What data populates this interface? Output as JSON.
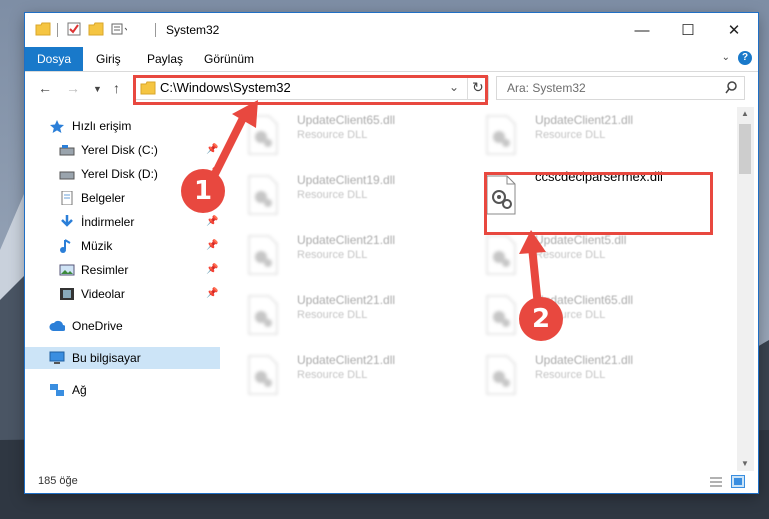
{
  "window": {
    "title": "System32",
    "controls": {
      "minimize": "—",
      "maximize": "☐",
      "close": "✕"
    }
  },
  "ribbon": {
    "tabs": [
      {
        "label": "Dosya",
        "active": true
      },
      {
        "label": "Giriş"
      },
      {
        "label": "Paylaş"
      },
      {
        "label": "Görünüm"
      }
    ],
    "help": "?"
  },
  "address": {
    "path": "C:\\Windows\\System32",
    "search_placeholder": "Ara: System32"
  },
  "sidebar": {
    "items": [
      {
        "label": "Hızlı erişim",
        "icon": "star-icon"
      },
      {
        "label": "Yerel Disk (C:)",
        "icon": "drive-icon",
        "pinned": true
      },
      {
        "label": "Yerel Disk (D:)",
        "icon": "drive-icon",
        "pinned": true
      },
      {
        "label": "Belgeler",
        "icon": "documents-icon",
        "pinned": true
      },
      {
        "label": "İndirmeler",
        "icon": "download-icon",
        "pinned": true
      },
      {
        "label": "Müzik",
        "icon": "music-icon",
        "pinned": true
      },
      {
        "label": "Resimler",
        "icon": "pictures-icon",
        "pinned": true
      },
      {
        "label": "Videolar",
        "icon": "videos-icon",
        "pinned": true
      },
      {
        "label": "OneDrive",
        "icon": "cloud-icon"
      },
      {
        "label": "Bu bilgisayar",
        "icon": "computer-icon",
        "selected": true
      },
      {
        "label": "Ağ",
        "icon": "network-icon"
      }
    ]
  },
  "files": [
    {
      "name": "UpdateClient65.dll",
      "type": "Resource DLL"
    },
    {
      "name": "UpdateClient21.dll",
      "type": "Resource DLL"
    },
    {
      "name": "UpdateClient19.dll",
      "type": "Resource DLL"
    },
    {
      "name": "ccscdeclparsermex.dll",
      "type": "",
      "selected": true
    },
    {
      "name": "UpdateClient21.dll",
      "type": "Resource DLL"
    },
    {
      "name": "UpdateClient5.dll",
      "type": "Resource DLL"
    },
    {
      "name": "UpdateClient21.dll",
      "type": "Resource DLL"
    },
    {
      "name": "UpdateClient65.dll",
      "type": "Resource DLL"
    },
    {
      "name": "UpdateClient21.dll",
      "type": "Resource DLL"
    },
    {
      "name": "UpdateClient21.dll",
      "type": "Resource DLL"
    }
  ],
  "status": {
    "count": "185 öğe"
  },
  "annotations": {
    "step1": "1",
    "step2": "2",
    "color": "#e8483f"
  }
}
